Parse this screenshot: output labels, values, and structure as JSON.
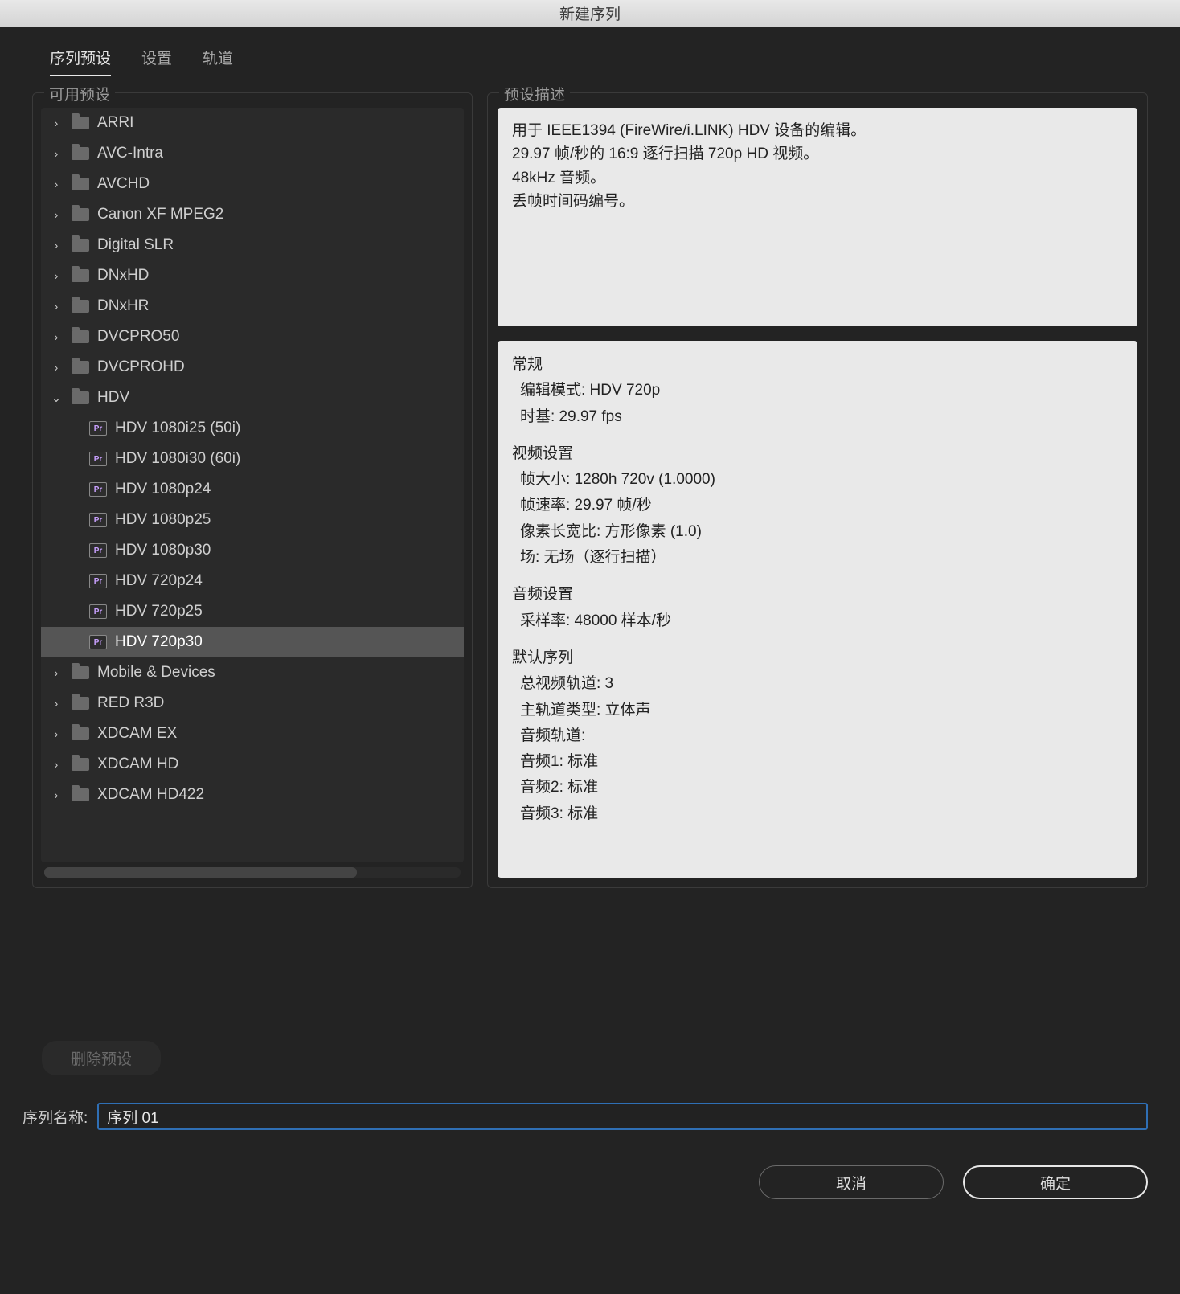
{
  "window_title": "新建序列",
  "tabs": [
    "序列预设",
    "设置",
    "轨道"
  ],
  "active_tab_index": 0,
  "left_panel_label": "可用预设",
  "right_panel_label": "预设描述",
  "tree": {
    "folders_top": [
      "ARRI",
      "AVC-Intra",
      "AVCHD",
      "Canon XF MPEG2",
      "Digital SLR",
      "DNxHD",
      "DNxHR",
      "DVCPRO50",
      "DVCPROHD"
    ],
    "expanded_folder": "HDV",
    "children": [
      "HDV 1080i25 (50i)",
      "HDV 1080i30 (60i)",
      "HDV 1080p24",
      "HDV 1080p25",
      "HDV 1080p30",
      "HDV 720p24",
      "HDV 720p25",
      "HDV 720p30"
    ],
    "selected_child_index": 7,
    "folders_bottom": [
      "Mobile & Devices",
      "RED R3D",
      "XDCAM EX",
      "XDCAM HD",
      "XDCAM HD422"
    ]
  },
  "description_lines": [
    "用于 IEEE1394 (FireWire/i.LINK) HDV 设备的编辑。",
    "29.97 帧/秒的 16:9 逐行扫描 720p HD 视频。",
    "48kHz 音频。",
    "丢帧时间码编号。"
  ],
  "details": {
    "general_title": "常规",
    "edit_mode": "编辑模式: HDV 720p",
    "timebase": "时基: 29.97 fps",
    "video_title": "视频设置",
    "frame_size": "帧大小: 1280h 720v (1.0000)",
    "frame_rate": "帧速率: 29.97  帧/秒",
    "pixel_aspect": "像素长宽比: 方形像素 (1.0)",
    "fields": "场: 无场（逐行扫描）",
    "audio_title": "音频设置",
    "sample_rate": "采样率: 48000 样本/秒",
    "default_seq_title": "默认序列",
    "video_tracks": "总视频轨道: 3",
    "master_track": "主轨道类型: 立体声",
    "audio_tracks_label": "音频轨道:",
    "audio1": "音频1: 标准",
    "audio2": "音频2: 标准",
    "audio3": "音频3: 标准"
  },
  "delete_preset_label": "删除预设",
  "sequence_name_label": "序列名称:",
  "sequence_name_value": "序列 01",
  "cancel_label": "取消",
  "ok_label": "确定"
}
